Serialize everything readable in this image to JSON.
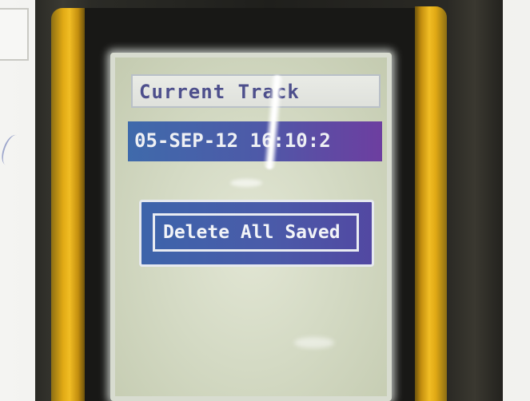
{
  "screen": {
    "heading": "Current Track",
    "track_entry": "05-SEP-12 16:10:2",
    "delete_button_label": "Delete All Saved"
  },
  "colors": {
    "heading_text": "#4d4f8c",
    "row_gradient_start": "#3f6aab",
    "row_gradient_end": "#6d3ea0",
    "device_rail": "#f1bd24"
  }
}
